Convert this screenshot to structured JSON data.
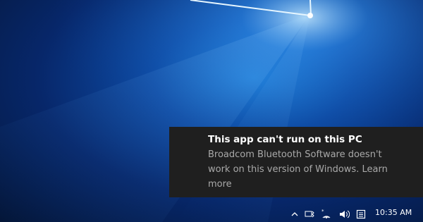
{
  "toast": {
    "title": "This app can't run on this PC",
    "body": "Broadcom Bluetooth Software doesn't work on this version of Windows. Learn more"
  },
  "taskbar": {
    "time": "10:35 AM",
    "tray_icons": [
      "chevron-up-icon",
      "bluetooth-icon",
      "network-icon",
      "volume-icon",
      "action-center-icon"
    ]
  },
  "colors": {
    "toast_bg": "#1f1f1f",
    "toast_title": "#ffffff",
    "toast_body": "#a9a9a9",
    "wallpaper_blue": "#0d4aa3"
  }
}
